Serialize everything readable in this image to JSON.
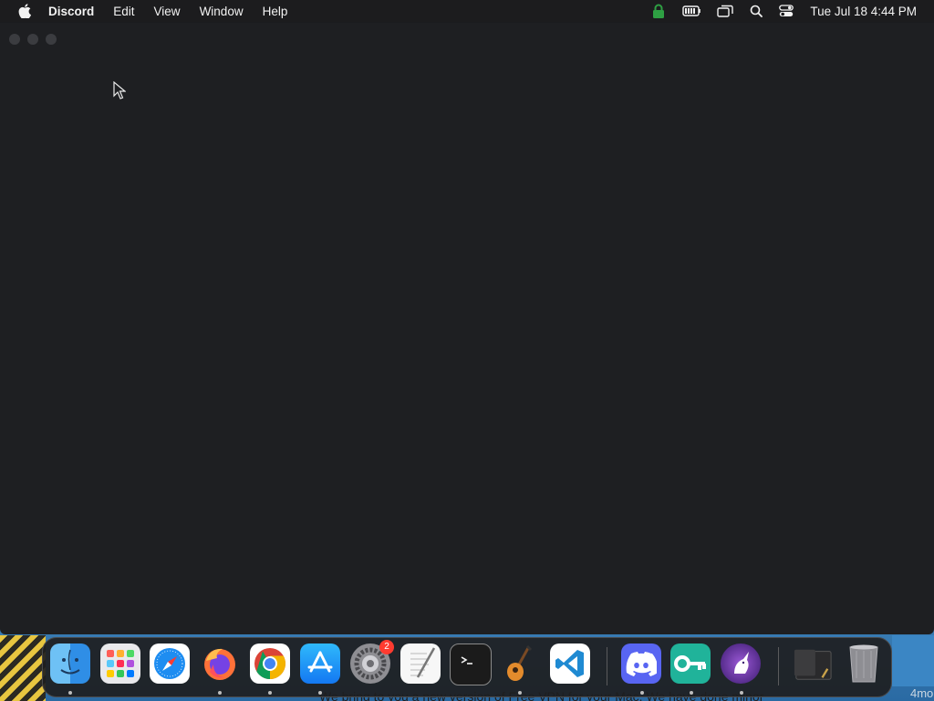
{
  "menubar": {
    "app_name": "Discord",
    "menus": [
      "Edit",
      "View",
      "Window",
      "Help"
    ],
    "clock": "Tue Jul 18  4:44 PM",
    "status_icons": [
      "vpn-lock-icon",
      "battery-icon",
      "screen-mirroring-icon",
      "spotlight-search-icon",
      "control-center-icon"
    ]
  },
  "desktop": {
    "background_text": "We bring to you a new version of Free VPN for your Mac. We have done minor",
    "right_text": "4mo"
  },
  "dock": {
    "items": [
      {
        "name": "finder",
        "running": true
      },
      {
        "name": "launchpad",
        "running": false
      },
      {
        "name": "safari",
        "running": false
      },
      {
        "name": "firefox",
        "running": true
      },
      {
        "name": "chrome",
        "running": true
      },
      {
        "name": "app-store",
        "running": true
      },
      {
        "name": "system-settings",
        "running": false,
        "badge": "2"
      },
      {
        "name": "textedit",
        "running": false
      },
      {
        "name": "terminal",
        "running": false
      },
      {
        "name": "garageband",
        "running": true
      },
      {
        "name": "vscode",
        "running": false
      },
      {
        "name": "discord",
        "running": true
      },
      {
        "name": "vpn-key",
        "running": true
      },
      {
        "name": "unicorn-vpn",
        "running": true
      },
      {
        "name": "downloads-stack",
        "running": false
      },
      {
        "name": "trash",
        "running": false
      }
    ]
  },
  "colors": {
    "menubar": "#1c1c1e",
    "window": "#1e1f22",
    "vpn_lock": "#2ea043",
    "discord": "#5865f2"
  }
}
